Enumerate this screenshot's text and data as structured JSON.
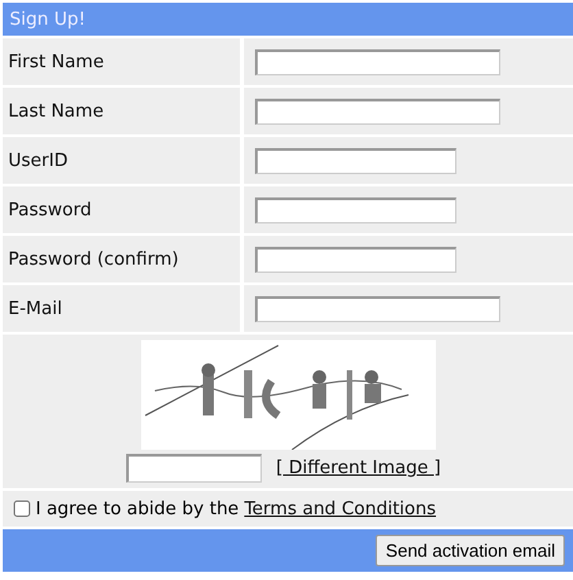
{
  "form": {
    "title": "Sign Up!",
    "fields": [
      {
        "label": "First Name",
        "kind": "long"
      },
      {
        "label": "Last Name",
        "kind": "long"
      },
      {
        "label": "UserID",
        "kind": "short"
      },
      {
        "label": "Password",
        "kind": "short"
      },
      {
        "label": "Password (confirm)",
        "kind": "short"
      },
      {
        "label": "E-Mail",
        "kind": "long"
      }
    ],
    "captcha": {
      "kind": "picture",
      "link": "[ Different Image ]"
    },
    "agreement": {
      "checked": false,
      "text": "I agree to abide by the",
      "link": "Terms and Conditions"
    },
    "submit": "Send activation email"
  }
}
